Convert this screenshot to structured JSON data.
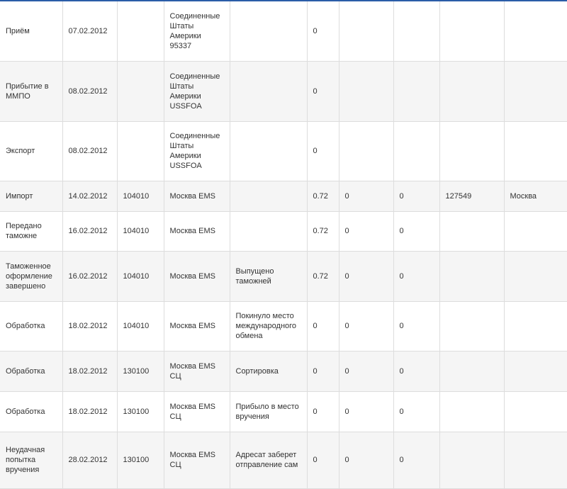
{
  "rows": [
    {
      "operation": "Приём",
      "date": "07.02.2012",
      "index": "",
      "place": "Соединенные Штаты Америки 95337",
      "attribute": "",
      "weight": "0",
      "declared_value": "",
      "cod": "",
      "dest_index": "",
      "dest_address": ""
    },
    {
      "operation": "Прибытие в ММПО",
      "date": "08.02.2012",
      "index": "",
      "place": "Соединенные Штаты Америки USSFOA",
      "attribute": "",
      "weight": "0",
      "declared_value": "",
      "cod": "",
      "dest_index": "",
      "dest_address": ""
    },
    {
      "operation": "Экспорт",
      "date": "08.02.2012",
      "index": "",
      "place": "Соединенные Штаты Америки USSFOA",
      "attribute": "",
      "weight": "0",
      "declared_value": "",
      "cod": "",
      "dest_index": "",
      "dest_address": ""
    },
    {
      "operation": "Импорт",
      "date": "14.02.2012",
      "index": "104010",
      "place": "Москва EMS",
      "attribute": "",
      "weight": "0.72",
      "declared_value": "0",
      "cod": "0",
      "dest_index": "127549",
      "dest_address": "Москва"
    },
    {
      "operation": "Передано таможне",
      "date": "16.02.2012",
      "index": "104010",
      "place": "Москва EMS",
      "attribute": "",
      "weight": "0.72",
      "declared_value": "0",
      "cod": "0",
      "dest_index": "",
      "dest_address": ""
    },
    {
      "operation": "Таможенное оформление завершено",
      "date": "16.02.2012",
      "index": "104010",
      "place": "Москва EMS",
      "attribute": "Выпущено таможней",
      "weight": "0.72",
      "declared_value": "0",
      "cod": "0",
      "dest_index": "",
      "dest_address": ""
    },
    {
      "operation": "Обработка",
      "date": "18.02.2012",
      "index": "104010",
      "place": "Москва EMS",
      "attribute": "Покинуло место международного обмена",
      "weight": "0",
      "declared_value": "0",
      "cod": "0",
      "dest_index": "",
      "dest_address": ""
    },
    {
      "operation": "Обработка",
      "date": "18.02.2012",
      "index": "130100",
      "place": "Москва EMS СЦ",
      "attribute": "Сортировка",
      "weight": "0",
      "declared_value": "0",
      "cod": "0",
      "dest_index": "",
      "dest_address": ""
    },
    {
      "operation": "Обработка",
      "date": "18.02.2012",
      "index": "130100",
      "place": "Москва EMS СЦ",
      "attribute": "Прибыло в место вручения",
      "weight": "0",
      "declared_value": "0",
      "cod": "0",
      "dest_index": "",
      "dest_address": ""
    },
    {
      "operation": "Неудачная попытка вручения",
      "date": "28.02.2012",
      "index": "130100",
      "place": "Москва EMS СЦ",
      "attribute": "Адресат заберет отправление сам",
      "weight": "0",
      "declared_value": "0",
      "cod": "0",
      "dest_index": "",
      "dest_address": ""
    }
  ]
}
